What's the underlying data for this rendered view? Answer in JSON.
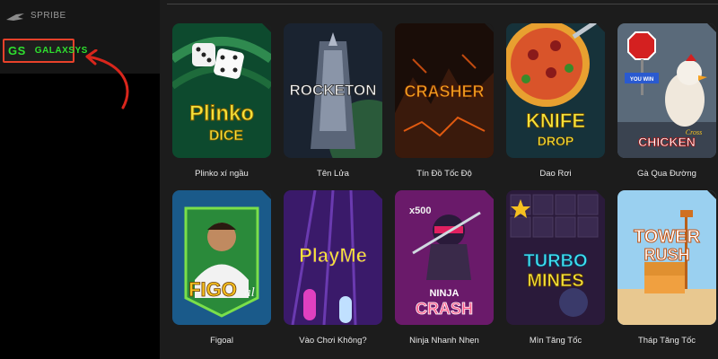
{
  "sidebar": {
    "providers": [
      {
        "label": "SPRIBE",
        "icon": "spribe-logo-icon",
        "selected": false
      },
      {
        "label": "GALAXSYS",
        "icon": "gs-logo-icon",
        "logo_text": "GS",
        "selected": true
      }
    ],
    "highlight_color": "#e8412a",
    "arrow_color": "#d9261c"
  },
  "games": [
    {
      "title": "Plinko xí ngầu",
      "art_text": [
        "Plinko",
        "DICE"
      ]
    },
    {
      "title": "Tên Lửa",
      "art_text": [
        "ROCKETON"
      ]
    },
    {
      "title": "Tín Đồ Tốc Độ",
      "art_text": [
        "CRASHER"
      ]
    },
    {
      "title": "Dao Rơi",
      "art_text": [
        "KNIFE",
        "DROP"
      ]
    },
    {
      "title": "Gà Qua Đường",
      "art_text": [
        "YOU WIN",
        "Cross",
        "CHICKEN"
      ]
    },
    {
      "title": "Figoal",
      "art_text": [
        "FIGO",
        "al"
      ]
    },
    {
      "title": "Vào Chơi Không?",
      "art_text": [
        "PlayMe"
      ]
    },
    {
      "title": "Ninja Nhanh Nhẹn",
      "art_text": [
        "x500",
        "NINJA",
        "CRASH"
      ]
    },
    {
      "title": "Mìn Tăng Tốc",
      "art_text": [
        "TURBO",
        "MINES"
      ]
    },
    {
      "title": "Tháp Tăng Tốc",
      "art_text": [
        "TOWER",
        "RUSH"
      ]
    }
  ]
}
